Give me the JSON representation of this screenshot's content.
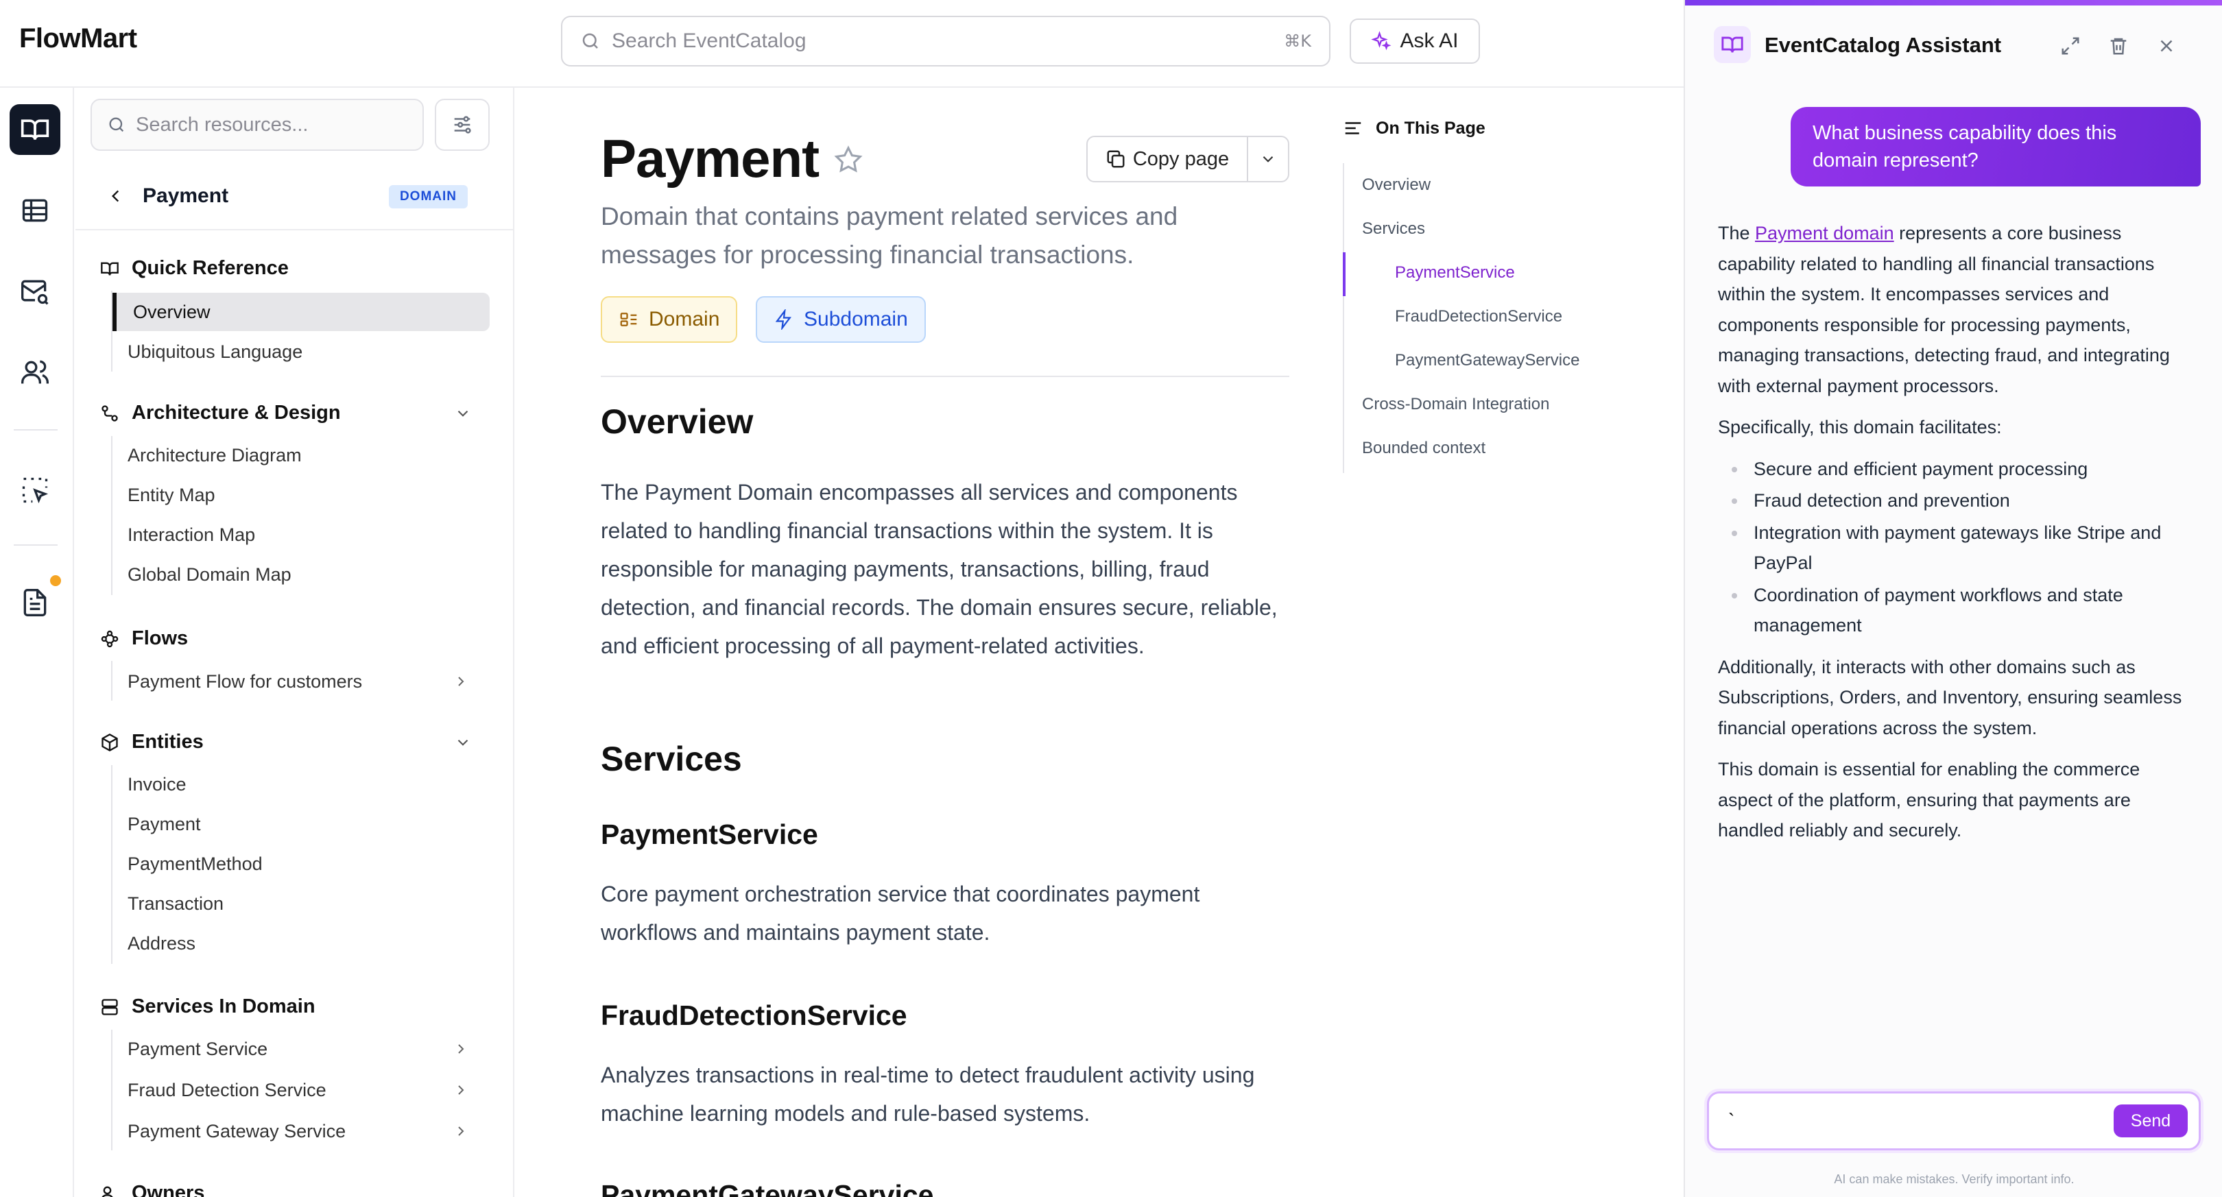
{
  "header": {
    "brand": "FlowMart",
    "search_placeholder": "Search EventCatalog",
    "search_shortcut": "⌘K",
    "ask_ai_label": "Ask AI"
  },
  "rail": {
    "items": [
      "docs-icon",
      "table-icon",
      "mail-search-icon",
      "users-icon",
      "select-icon",
      "document-icon"
    ]
  },
  "sidebar": {
    "search_placeholder": "Search resources...",
    "back_title": "Payment",
    "back_badge": "DOMAIN",
    "sections": {
      "quick_reference": {
        "title": "Quick Reference",
        "items": [
          "Overview",
          "Ubiquitous Language"
        ]
      },
      "architecture": {
        "title": "Architecture & Design",
        "items": [
          "Architecture Diagram",
          "Entity Map",
          "Interaction Map",
          "Global Domain Map"
        ]
      },
      "flows": {
        "title": "Flows",
        "items": [
          "Payment Flow for customers"
        ]
      },
      "entities": {
        "title": "Entities",
        "items": [
          "Invoice",
          "Payment",
          "PaymentMethod",
          "Transaction",
          "Address"
        ]
      },
      "services": {
        "title": "Services In Domain",
        "items": [
          "Payment Service",
          "Fraud Detection Service",
          "Payment Gateway Service"
        ]
      },
      "owners": {
        "title": "Owners"
      }
    }
  },
  "main": {
    "title": "Payment",
    "subtitle": "Domain that contains payment related services and messages for processing financial transactions.",
    "copy_label": "Copy page",
    "tags": [
      "Domain",
      "Subdomain"
    ],
    "overview_heading": "Overview",
    "overview_text": "The Payment Domain encompasses all services and components related to handling financial transactions within the system. It is responsible for managing payments, transactions, billing, fraud detection, and financial records. The domain ensures secure, reliable, and efficient processing of all payment-related activities.",
    "services_heading": "Services",
    "services": [
      {
        "name": "PaymentService",
        "desc": "Core payment orchestration service that coordinates payment workflows and maintains payment state."
      },
      {
        "name": "FraudDetectionService",
        "desc": "Analyzes transactions in real-time to detect fraudulent activity using machine learning models and rule-based systems."
      },
      {
        "name": "PaymentGatewayService",
        "desc": ""
      }
    ]
  },
  "toc": {
    "heading": "On This Page",
    "items": [
      "Overview",
      "Services",
      "PaymentService",
      "FraudDetectionService",
      "PaymentGatewayService",
      "Cross-Domain Integration",
      "Bounded context"
    ]
  },
  "assistant": {
    "title": "EventCatalog Assistant",
    "user_message": "What business capability does this domain represent?",
    "answer_p1_pre": "The ",
    "answer_link": "Payment domain",
    "answer_p1_post": " represents a core business capability related to handling all financial transactions within the system. It encompasses services and components responsible for processing payments, managing transactions, detecting fraud, and integrating with external payment processors.",
    "answer_p2": "Specifically, this domain facilitates:",
    "answer_bullets": [
      "Secure and efficient payment processing",
      "Fraud detection and prevention",
      "Integration with payment gateways like Stripe and PayPal",
      "Coordination of payment workflows and state management"
    ],
    "answer_p3": "Additionally, it interacts with other domains such as Subscriptions, Orders, and Inventory, ensuring seamless financial operations across the system.",
    "answer_p4": "This domain is essential for enabling the commerce aspect of the platform, ensuring that payments are handled reliably and securely.",
    "input_value": "`",
    "send_label": "Send",
    "disclaimer": "AI can make mistakes. Verify important info."
  },
  "colors": {
    "accent": "#9333ea",
    "domain_tag_bg": "#fef9e6",
    "subdomain_tag_bg": "#eaf3ff",
    "rail_active": "#111827"
  }
}
